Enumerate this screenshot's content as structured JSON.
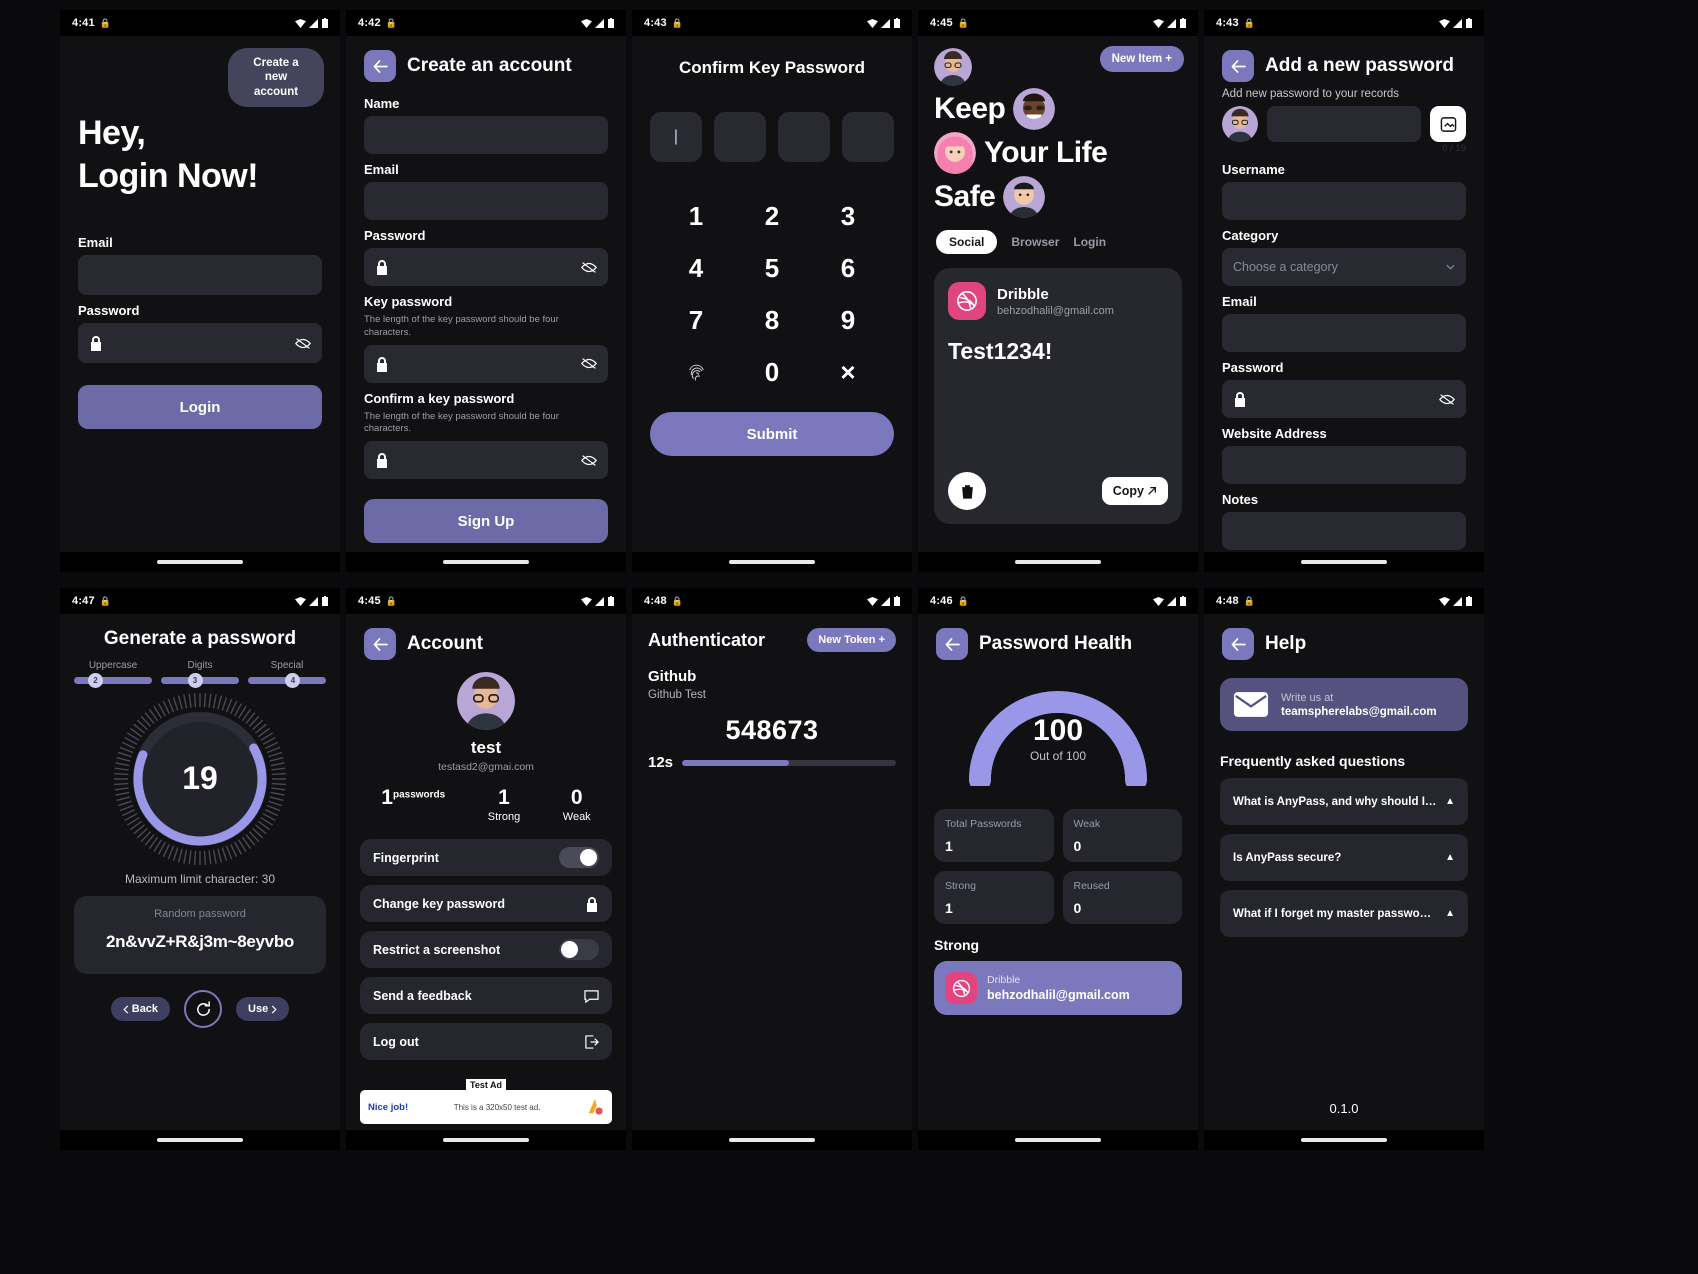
{
  "colors": {
    "accent": "#7b78bd",
    "accent_dark": "#6d6aa8",
    "bg": "#111114",
    "field": "#292931",
    "card": "#26262e",
    "dribble": "#e0457f"
  },
  "screens": [
    {
      "id": "login",
      "status": {
        "time": "4:41"
      },
      "create_account_label": "Create a new\naccount",
      "heading_line1": "Hey,",
      "heading_line2": "Login Now!",
      "email_label": "Email",
      "password_label": "Password",
      "login_button": "Login"
    },
    {
      "id": "create-account",
      "status": {
        "time": "4:42"
      },
      "title": "Create an account",
      "name_label": "Name",
      "email_label": "Email",
      "password_label": "Password",
      "key_password_label": "Key password",
      "key_password_hint": "The length of the key password should be four characters.",
      "confirm_key_label": "Confirm a key password",
      "confirm_key_hint": "The length of the key password should be four characters.",
      "signup_button": "Sign Up"
    },
    {
      "id": "confirm-key-password",
      "status": {
        "time": "4:43"
      },
      "title": "Confirm Key Password",
      "otp_cells": [
        "|",
        "",
        "",
        ""
      ],
      "keys": [
        "1",
        "2",
        "3",
        "4",
        "5",
        "6",
        "7",
        "8",
        "9",
        "fingerprint-icon",
        "0",
        "×"
      ],
      "submit_button": "Submit"
    },
    {
      "id": "home",
      "status": {
        "time": "4:45"
      },
      "new_item_label": "New Item +",
      "hero_line1": "Keep",
      "hero_line2": "Your Life",
      "hero_line3": "Safe",
      "tabs": [
        {
          "label": "Social",
          "active": true
        },
        {
          "label": "Browser",
          "active": false
        },
        {
          "label": "Login",
          "active": false
        }
      ],
      "card": {
        "name": "Dribble",
        "email": "behzodhalil@gmail.com",
        "password": "Test1234!",
        "copy_label": "Copy"
      }
    },
    {
      "id": "add-password",
      "status": {
        "time": "4:43"
      },
      "title": "Add a new password",
      "subtitle": "Add new password to your records",
      "counter": "0 / 19",
      "username_label": "Username",
      "category_label": "Category",
      "category_placeholder": "Choose a category",
      "email_label": "Email",
      "password_label": "Password",
      "website_label": "Website Address",
      "notes_label": "Notes"
    },
    {
      "id": "generate-password",
      "status": {
        "time": "4:47"
      },
      "title": "Generate a password",
      "sliders": [
        {
          "label": "Uppercase",
          "value": "2",
          "pct": 22
        },
        {
          "label": "Digits",
          "value": "3",
          "pct": 38
        },
        {
          "label": "Special",
          "value": "4",
          "pct": 52
        }
      ],
      "dial_value": "19",
      "max_limit": "Maximum limit character: 30",
      "random_label": "Random password",
      "random_value": "2n&vvZ+R&j3m~8eyvbo",
      "back_button": "Back",
      "use_button": "Use",
      "refresh_icon": "refresh-icon"
    },
    {
      "id": "account",
      "status": {
        "time": "4:45"
      },
      "title": "Account",
      "name": "test",
      "email": "testasd2@gmai.com",
      "stats": [
        {
          "value": "1",
          "sup": "passwords",
          "caption": ""
        },
        {
          "value": "1",
          "sup": "",
          "caption": "Strong"
        },
        {
          "value": "0",
          "sup": "",
          "caption": "Weak"
        }
      ],
      "rows": [
        {
          "label": "Fingerprint",
          "type": "toggle",
          "on": true
        },
        {
          "label": "Change key password",
          "type": "icon",
          "icon": "lock-icon"
        },
        {
          "label": "Restrict a screenshot",
          "type": "toggle",
          "on": false
        },
        {
          "label": "Send a feedback",
          "type": "icon",
          "icon": "message-icon"
        },
        {
          "label": "Log out",
          "type": "icon",
          "icon": "logout-icon"
        }
      ],
      "ad": {
        "badge": "Test Ad",
        "left": "Nice job!",
        "mid": "This is a 320x50 test ad."
      }
    },
    {
      "id": "authenticator",
      "status": {
        "time": "4:48"
      },
      "title": "Authenticator",
      "new_token_label": "New Token +",
      "token_name": "Github",
      "token_sub": "Github Test",
      "code": "548673",
      "timer": "12s",
      "timer_pct": 50
    },
    {
      "id": "password-health",
      "status": {
        "time": "4:46"
      },
      "title": "Password Health",
      "score": "100",
      "score_sub": "Out of 100",
      "cards": [
        {
          "key": "Total Passwords",
          "value": "1"
        },
        {
          "key": "Weak",
          "value": "0"
        },
        {
          "key": "Strong",
          "value": "1"
        },
        {
          "key": "Reused",
          "value": "0"
        }
      ],
      "section_title": "Strong",
      "entry": {
        "name": "Dribble",
        "email": "behzodhalil@gmail.com"
      }
    },
    {
      "id": "help",
      "status": {
        "time": "4:48"
      },
      "title": "Help",
      "mail_top": "Write us at",
      "mail_address": "teamspherelabs@gmail.com",
      "faq_heading": "Frequently asked questions",
      "faqs": [
        "What is AnyPass, and why should I…",
        "Is AnyPass secure?",
        "What if I forget my master passwo…"
      ],
      "version": "0.1.0"
    }
  ]
}
